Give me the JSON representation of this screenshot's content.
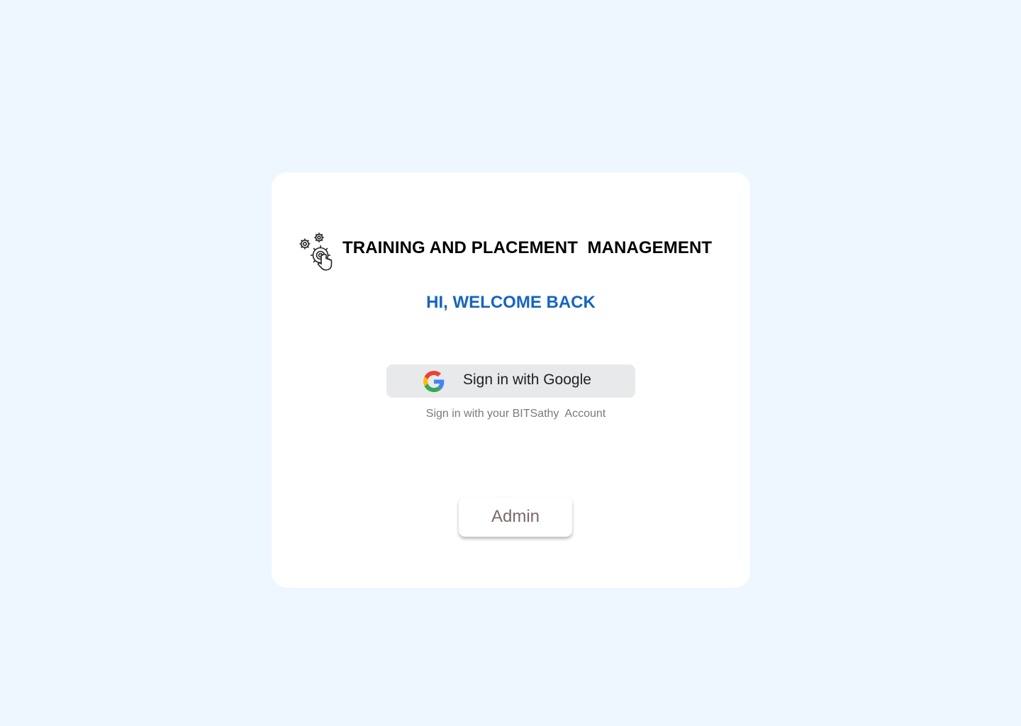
{
  "header": {
    "logo_icon": "gears-hand-click-icon",
    "title": "TRAINING AND PLACEMENT  MANAGEMENT"
  },
  "welcome": {
    "text": "HI, WELCOME BACK",
    "color": "#1565c0"
  },
  "google_signin": {
    "icon": "google-g-icon",
    "label": "Sign in with Google",
    "hint": "Sign in with your BITSathy  Account"
  },
  "admin": {
    "label": "Admin"
  },
  "colors": {
    "background": "#eef6ff",
    "card": "#ffffff",
    "google_button": "#e8e9eb"
  }
}
